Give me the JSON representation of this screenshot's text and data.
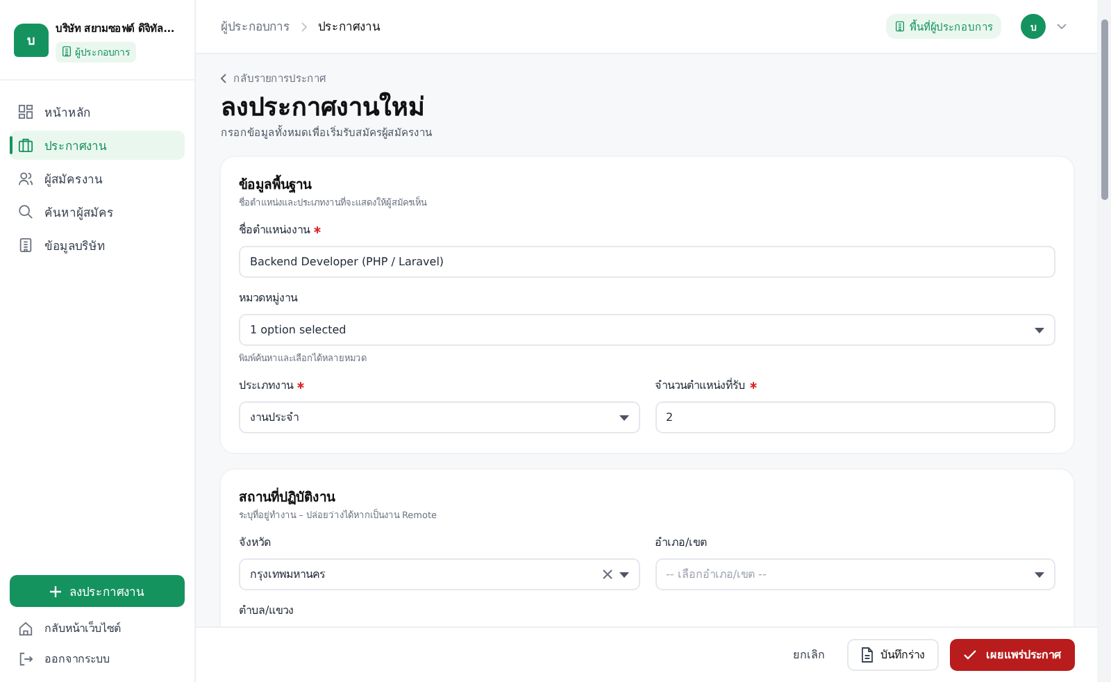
{
  "sidebar": {
    "logo_letter": "บ",
    "company": "บริษัท สยามซอฟต์ ดิจิทัล...",
    "role_badge": "ผู้ประกอบการ",
    "nav": [
      {
        "label": "หน้าหลัก",
        "selected": false
      },
      {
        "label": "ประกาศงาน",
        "selected": true
      },
      {
        "label": "ผู้สมัครงาน",
        "selected": false
      },
      {
        "label": "ค้นหาผู้สมัคร",
        "selected": false
      },
      {
        "label": "ข้อมูลบริษัท",
        "selected": false
      }
    ],
    "post_button": "ลงประกาศงาน",
    "footer_links": [
      {
        "label": "กลับหน้าเว็บไซต์"
      },
      {
        "label": "ออกจากระบบ"
      }
    ]
  },
  "topbar": {
    "breadcrumb": [
      "ผู้ประกอบการ",
      "ประกาศงาน"
    ],
    "workspace_badge": "พื้นที่ผู้ประกอบการ",
    "avatar_letter": "บ"
  },
  "page": {
    "back_link": "กลับรายการประกาศ",
    "title": "ลงประกาศงานใหม่",
    "subtitle": "กรอกข้อมูลทั้งหมดเพื่อเริ่มรับสมัครผู้สมัครงาน",
    "sections": [
      {
        "title": "ข้อมูลพื้นฐาน",
        "subtitle": "ชื่อตำแหน่งและประเภทงานที่จะแสดงให้ผู้สมัครเห็น",
        "rows": [
          [
            {
              "kind": "text",
              "label": "ชื่อตำแหน่งงาน",
              "required": true,
              "value": "Backend Developer (PHP / Laravel)"
            }
          ],
          [
            {
              "kind": "select",
              "label": "หมวดหมู่งาน",
              "required": false,
              "value": "1 option selected",
              "hint": "พิมพ์ค้นหาและเลือกได้หลายหมวด"
            }
          ],
          [
            {
              "kind": "select",
              "label": "ประเภทงาน",
              "required": true,
              "value": "งานประจำ"
            },
            {
              "kind": "text",
              "label": "จำนวนตำแหน่งที่รับ",
              "required": true,
              "value": "2"
            }
          ]
        ]
      },
      {
        "title": "สถานที่ปฏิบัติงาน",
        "subtitle": "ระบุที่อยู่ทำงาน – ปล่อยว่างได้หากเป็นงาน Remote",
        "rows": [
          [
            {
              "kind": "select",
              "label": "จังหวัด",
              "required": false,
              "value": "กรุงเทพมหานคร",
              "clearable": true
            },
            {
              "kind": "select",
              "label": "อำเภอ/เขต",
              "required": false,
              "placeholder": "-- เลือกอำเภอ/เขต --"
            }
          ],
          [
            {
              "kind": "hidden",
              "label": "ตำบล/แขวง",
              "required": false
            }
          ]
        ]
      }
    ]
  },
  "actions": {
    "cancel": "ยกเลิก",
    "save_draft": "บันทึกร่าง",
    "publish": "เผยแพร่ประกาศ"
  }
}
